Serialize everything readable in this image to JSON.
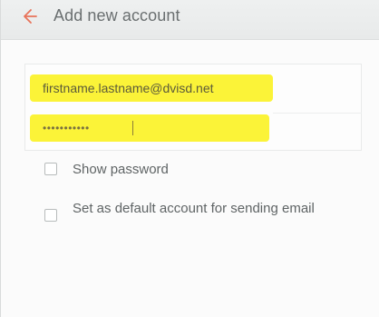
{
  "header": {
    "title": "Add new account",
    "back_icon": "arrow-left-icon"
  },
  "form": {
    "email_value": "firstname.lastname@dvisd.net",
    "password_value": "•••••••••••"
  },
  "options": {
    "show_password_label": "Show password",
    "default_account_label": "Set as default account for sending email"
  },
  "colors": {
    "accent": "#e8735a",
    "highlight": "#fbf338"
  }
}
